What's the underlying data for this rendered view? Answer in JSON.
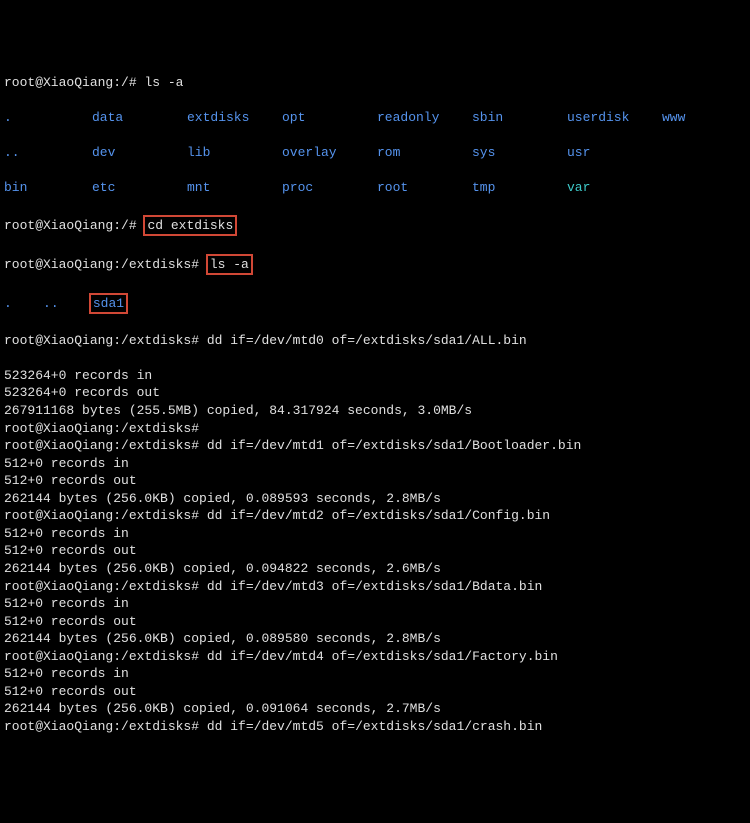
{
  "prompt1": "root@XiaoQiang:/# ",
  "cmd_ls1": "ls -a",
  "ls_root": {
    "row1": [
      ".",
      "data",
      "extdisks",
      "opt",
      "readonly",
      "sbin",
      "userdisk",
      "www"
    ],
    "row2": [
      "..",
      "dev",
      "lib",
      "overlay",
      "rom",
      "sys",
      "usr"
    ],
    "row3": [
      "bin",
      "etc",
      "mnt",
      "proc",
      "root",
      "tmp",
      "var"
    ]
  },
  "prompt2": "root@XiaoQiang:/# ",
  "cmd_cd": "cd extdisks",
  "prompt3": "root@XiaoQiang:/extdisks# ",
  "cmd_ls2": "ls -a",
  "ls_ext": {
    "dot": ".",
    "dotdot": "..",
    "dir": "sda1"
  },
  "prompt_ext": "root@XiaoQiang:/extdisks# ",
  "dd": [
    {
      "cmd": "dd if=/dev/mtd0 of=/extdisks/sda1/ALL.bin",
      "rec_in": "523264+0 records in",
      "rec_out": "523264+0 records out",
      "bytes": "267911168 bytes (255.5MB) copied, 84.317924 seconds, 3.0MB/s",
      "pre_blank": true,
      "post_blank": false,
      "extra_prompt": true
    },
    {
      "cmd": "dd if=/dev/mtd1 of=/extdisks/sda1/Bootloader.bin",
      "rec_in": "512+0 records in",
      "rec_out": "512+0 records out",
      "bytes": "262144 bytes (256.0KB) copied, 0.089593 seconds, 2.8MB/s"
    },
    {
      "cmd": "dd if=/dev/mtd2 of=/extdisks/sda1/Config.bin",
      "rec_in": "512+0 records in",
      "rec_out": "512+0 records out",
      "bytes": "262144 bytes (256.0KB) copied, 0.094822 seconds, 2.6MB/s"
    },
    {
      "cmd": "dd if=/dev/mtd3 of=/extdisks/sda1/Bdata.bin",
      "rec_in": "512+0 records in",
      "rec_out": "512+0 records out",
      "bytes": "262144 bytes (256.0KB) copied, 0.089580 seconds, 2.8MB/s"
    },
    {
      "cmd": "dd if=/dev/mtd4 of=/extdisks/sda1/Factory.bin",
      "rec_in": "512+0 records in",
      "rec_out": "512+0 records out",
      "bytes": "262144 bytes (256.0KB) copied, 0.091064 seconds, 2.7MB/s"
    },
    {
      "cmd": "dd if=/dev/mtd5 of=/extdisks/sda1/crash.bin"
    }
  ]
}
